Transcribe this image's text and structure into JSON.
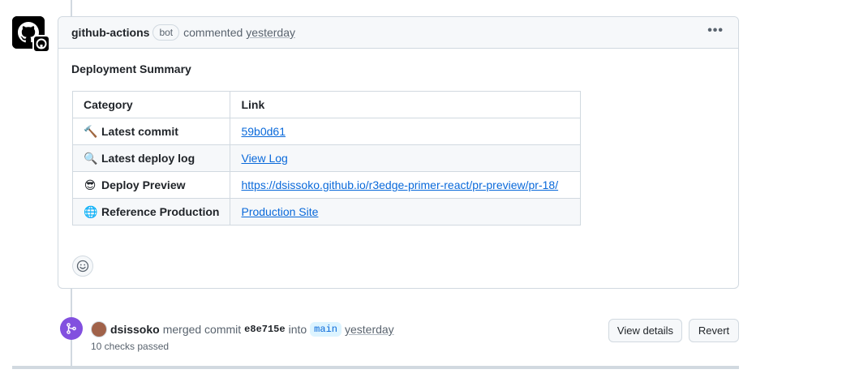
{
  "comment": {
    "author": "github-actions",
    "badge": "bot",
    "verb": "commented",
    "when": "yesterday",
    "menu_label": "•••",
    "title": "Deployment Summary",
    "table": {
      "headers": [
        "Category",
        "Link"
      ],
      "rows": [
        {
          "emoji": "🔨",
          "category": "Latest commit",
          "link": "59b0d61"
        },
        {
          "emoji": "🔍",
          "category": "Latest deploy log",
          "link": "View Log"
        },
        {
          "emoji": "😎",
          "category": "Deploy Preview",
          "link": "https://dsissoko.github.io/r3edge-primer-react/pr-preview/pr-18/"
        },
        {
          "emoji": "🌐",
          "category": "Reference Production",
          "link": "Production Site"
        }
      ]
    },
    "reaction_icon": "smiley-icon"
  },
  "merge_event": {
    "user": "dsissoko",
    "action": "merged commit",
    "sha": "e8e715e",
    "into": "into",
    "branch": "main",
    "when": "yesterday",
    "checks": "10 checks passed",
    "view_details_label": "View details",
    "revert_label": "Revert"
  },
  "colors": {
    "link": "#0969da",
    "merged": "#8250df",
    "border": "#d1d9e0",
    "header_bg": "#f6f8fa"
  }
}
